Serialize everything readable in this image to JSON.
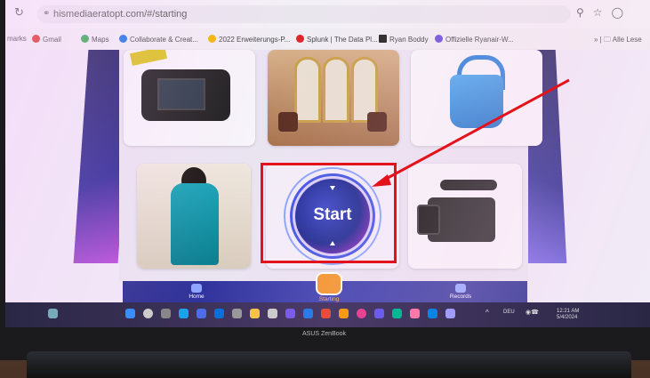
{
  "browser": {
    "url": "hismediaeratopt.com/#/starting",
    "bookmarks": [
      {
        "label": "marks",
        "color": "#888888"
      },
      {
        "label": "Gmail",
        "color": "#d93025"
      },
      {
        "label": "Maps",
        "color": "#34a853"
      },
      {
        "label": "Collaborate & Creat...",
        "color": "#1a73e8"
      },
      {
        "label": "2022 Erweiterungs-P...",
        "color": "#f4b400"
      },
      {
        "label": "Splunk | The Data Pl...",
        "color": "#e0242a"
      },
      {
        "label": "Ryan Boddy",
        "color": "#222222"
      },
      {
        "label": "Offizielle Ryanair-W...",
        "color": "#6a4fd8"
      }
    ],
    "other_bookmarks": "Alle Lese"
  },
  "start_button": {
    "label": "Start"
  },
  "app_nav": {
    "home": "Home",
    "starting": "Starting",
    "records": "Records"
  },
  "taskbar": {
    "tray_lang": "DEU",
    "time": "12:21 AM",
    "date": "5/4/2024"
  },
  "device_brand": "ASUS ZenBook",
  "colors": {
    "annotation": "#e3121b",
    "nav_bg": "#2a2c8e",
    "accent_orange": "#f29427"
  }
}
